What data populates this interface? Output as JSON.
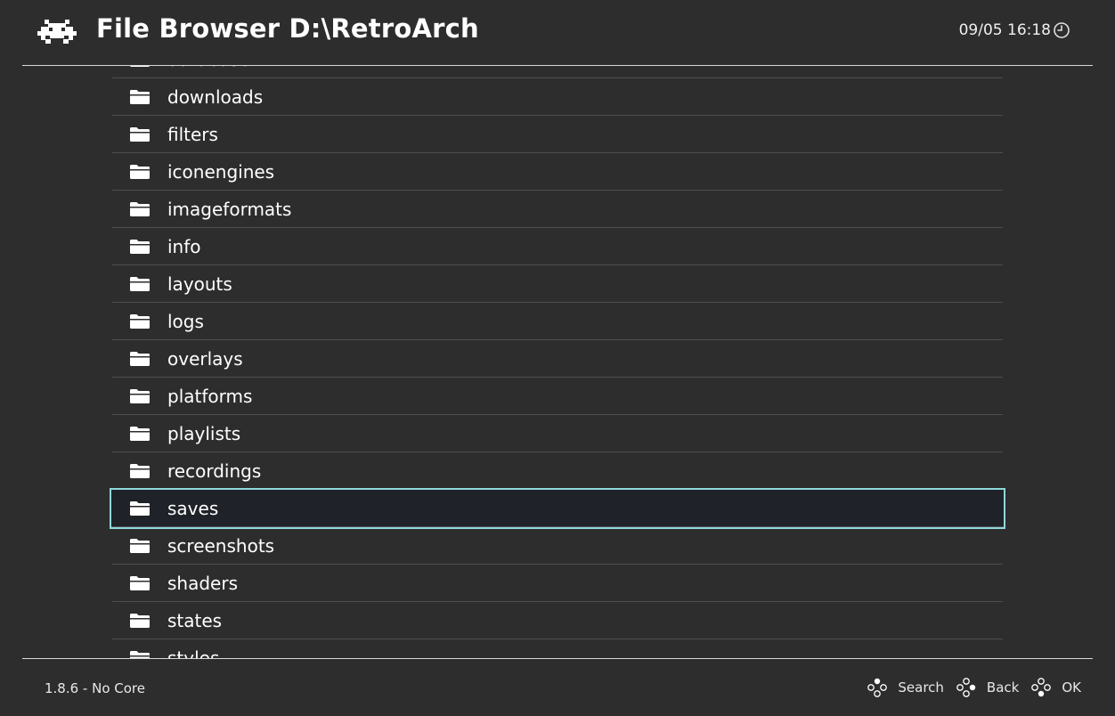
{
  "header": {
    "title": "File Browser D:\\RetroArch",
    "clock": "09/05 16:18"
  },
  "list": {
    "items": [
      {
        "label": "database"
      },
      {
        "label": "downloads"
      },
      {
        "label": "filters"
      },
      {
        "label": "iconengines"
      },
      {
        "label": "imageformats"
      },
      {
        "label": "info"
      },
      {
        "label": "layouts"
      },
      {
        "label": "logs"
      },
      {
        "label": "overlays"
      },
      {
        "label": "platforms"
      },
      {
        "label": "playlists"
      },
      {
        "label": "recordings"
      },
      {
        "label": "saves",
        "selected": true
      },
      {
        "label": "screenshots"
      },
      {
        "label": "shaders"
      },
      {
        "label": "states"
      },
      {
        "label": "styles"
      }
    ]
  },
  "footer": {
    "version": "1.8.6 - No Core",
    "buttons": [
      {
        "label": "Search",
        "icon": "gamepad-face-top-icon"
      },
      {
        "label": "Back",
        "icon": "gamepad-face-right-icon"
      },
      {
        "label": "OK",
        "icon": "gamepad-face-bottom-icon"
      }
    ]
  },
  "colors": {
    "background": "#2d2d2d",
    "selection_border": "#8fd8dc",
    "selection_fill": "#202229",
    "divider": "#4e4e4e",
    "text": "#ffffff"
  }
}
